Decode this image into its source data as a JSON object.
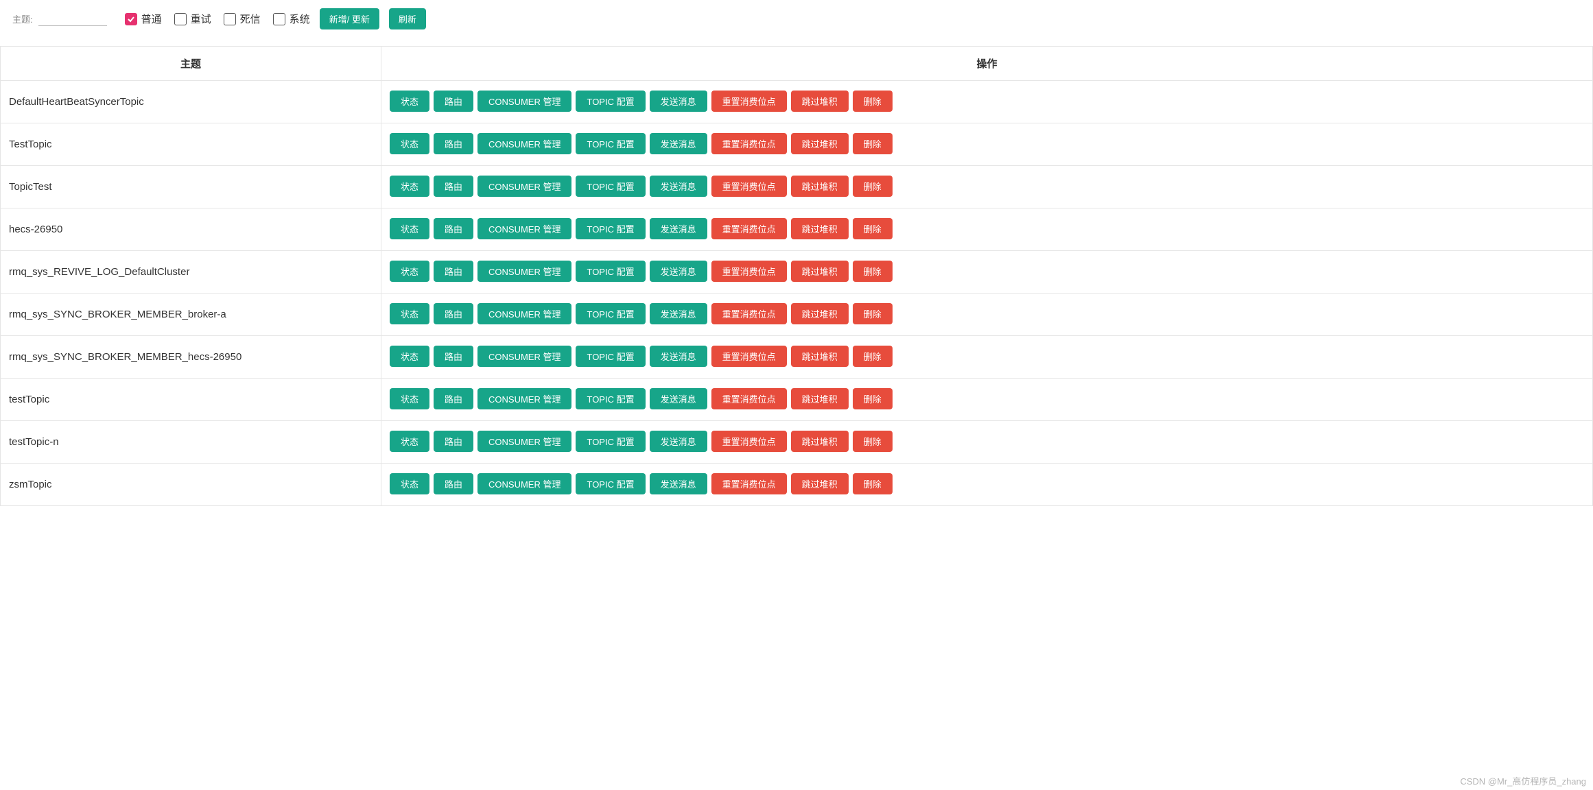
{
  "filter": {
    "label": "主题:",
    "input_value": "",
    "checkboxes": [
      {
        "label": "普通",
        "checked": true
      },
      {
        "label": "重试",
        "checked": false
      },
      {
        "label": "死信",
        "checked": false
      },
      {
        "label": "系统",
        "checked": false
      }
    ],
    "add_update_btn": "新增/ 更新",
    "refresh_btn": "刷新"
  },
  "table": {
    "headers": {
      "topic": "主题",
      "actions": "操作"
    },
    "action_labels": {
      "status": "状态",
      "route": "路由",
      "consumer": "CONSUMER 管理",
      "config": "TOPIC 配置",
      "send": "发送消息",
      "reset": "重置消费位点",
      "skip": "跳过堆积",
      "delete": "删除"
    },
    "rows": [
      {
        "name": "DefaultHeartBeatSyncerTopic"
      },
      {
        "name": "TestTopic"
      },
      {
        "name": "TopicTest"
      },
      {
        "name": "hecs-26950"
      },
      {
        "name": "rmq_sys_REVIVE_LOG_DefaultCluster"
      },
      {
        "name": "rmq_sys_SYNC_BROKER_MEMBER_broker-a"
      },
      {
        "name": "rmq_sys_SYNC_BROKER_MEMBER_hecs-26950"
      },
      {
        "name": "testTopic"
      },
      {
        "name": "testTopic-n"
      },
      {
        "name": "zsmTopic"
      }
    ]
  },
  "watermark": "CSDN @Mr_高仿程序员_zhang"
}
